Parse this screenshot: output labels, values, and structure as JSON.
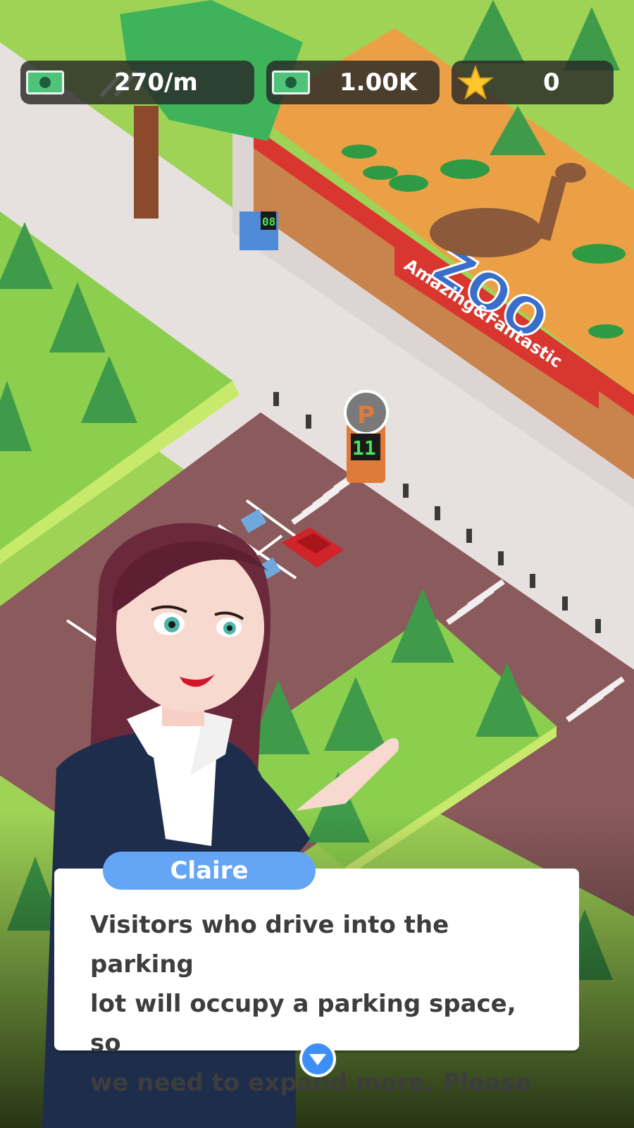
{
  "hud": {
    "income_rate": "270/m",
    "money": "1.00K",
    "stars": "0"
  },
  "scene": {
    "zoo_sign_main": "ZOO",
    "zoo_sign_sub": "Amazing&Fantastic",
    "gate_counter": "08",
    "parking_sign_letter": "P",
    "parking_counter": "11"
  },
  "dialog": {
    "speaker_name": "Claire",
    "text": "Visitors who drive into the parking\nlot will occupy a parking space, so\nwe need to expand more.  Please"
  },
  "colors": {
    "grass": "#9fd356",
    "road": "#e6e1df",
    "parking_lot": "#8a5a5c",
    "zoo_red": "#d8362f",
    "name_tag": "#64a5f5",
    "next_button": "#3d8ff5"
  }
}
